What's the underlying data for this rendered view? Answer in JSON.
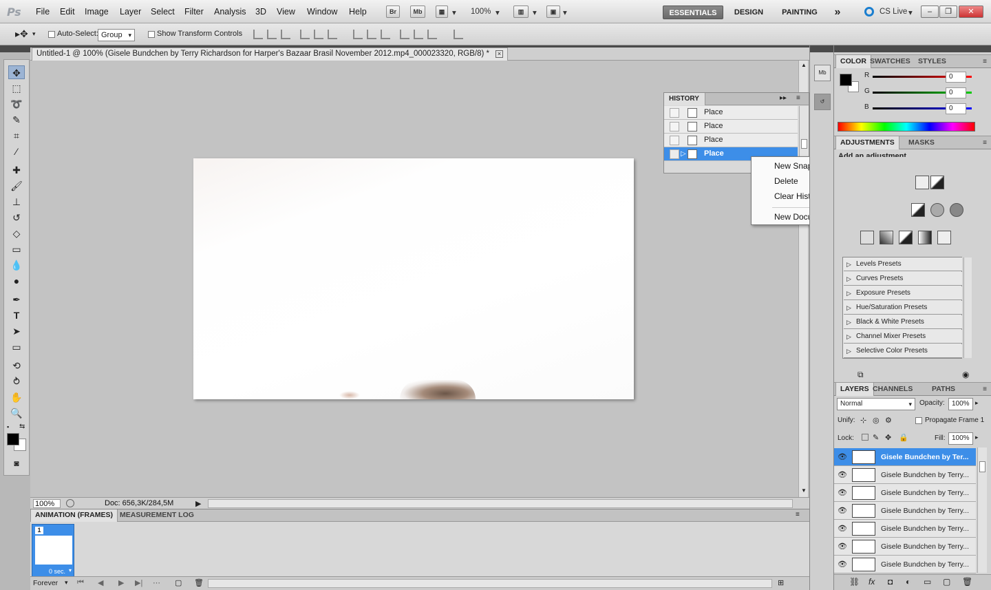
{
  "menubar": {
    "logo": "Ps",
    "menus": [
      "File",
      "Edit",
      "Image",
      "Layer",
      "Select",
      "Filter",
      "Analysis",
      "3D",
      "View",
      "Window",
      "Help"
    ],
    "br": "Br",
    "mb": "Mb",
    "zoom": "100%",
    "workspaces": [
      "ESSENTIALS",
      "DESIGN",
      "PAINTING"
    ],
    "more": "»",
    "cslive": "CS Live"
  },
  "options": {
    "auto_select_label": "Auto-Select:",
    "auto_select_value": "Group",
    "transform_label": "Show Transform Controls"
  },
  "document": {
    "tab_title": "Untitled-1 @ 100% (Gisele Bundchen by Terry Richardson for Harper's Bazaar Brasil November 2012.mp4_000023320, RGB/8) *",
    "zoom": "100%",
    "doc_info": "Doc: 656,3K/284,5M"
  },
  "history": {
    "title": "HISTORY",
    "rows": [
      "Place",
      "Place",
      "Place",
      "Place"
    ]
  },
  "context_menu": {
    "items": [
      "New Snapshot...",
      "Delete",
      "Clear History",
      "New Document"
    ]
  },
  "color_panel": {
    "tabs": [
      "COLOR",
      "SWATCHES",
      "STYLES"
    ],
    "r_label": "R",
    "g_label": "G",
    "b_label": "B",
    "r": "0",
    "g": "0",
    "b": "0"
  },
  "adjustments": {
    "tabs": [
      "ADJUSTMENTS",
      "MASKS"
    ],
    "heading": "Add an adjustment",
    "presets": [
      "Levels Presets",
      "Curves Presets",
      "Exposure Presets",
      "Hue/Saturation Presets",
      "Black & White Presets",
      "Channel Mixer Presets",
      "Selective Color Presets"
    ]
  },
  "layers": {
    "tabs": [
      "LAYERS",
      "CHANNELS",
      "PATHS"
    ],
    "blend_mode": "Normal",
    "opacity_label": "Opacity:",
    "opacity": "100%",
    "unify_label": "Unify:",
    "propagate_label": "Propagate Frame 1",
    "lock_label": "Lock:",
    "fill_label": "Fill:",
    "fill": "100%",
    "items": [
      "Gisele Bundchen by Ter...",
      "Gisele Bundchen by Terry...",
      "Gisele Bundchen by Terry...",
      "Gisele Bundchen by Terry...",
      "Gisele Bundchen by Terry...",
      "Gisele Bundchen by Terry...",
      "Gisele Bundchen by Terry..."
    ]
  },
  "animation": {
    "tabs": [
      "ANIMATION (FRAMES)",
      "MEASUREMENT LOG"
    ],
    "frame_number": "1",
    "frame_delay": "0 sec.",
    "loop": "Forever"
  },
  "colors": {
    "selection_blue": "#3d8ee8",
    "dark_strip": "#4a4a4a"
  }
}
